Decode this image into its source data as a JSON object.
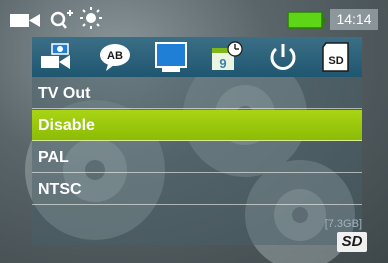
{
  "status": {
    "clock": "14:14",
    "icons": [
      "video-camera-icon",
      "zoom-icon",
      "white-balance-icon",
      "battery-icon"
    ],
    "battery_color": "#5cd615"
  },
  "tabs": [
    {
      "icon": "video-settings-icon"
    },
    {
      "icon": "language-icon",
      "text": "AB"
    },
    {
      "icon": "display-icon"
    },
    {
      "icon": "date-time-icon",
      "text": "9"
    },
    {
      "icon": "power-icon"
    },
    {
      "icon": "sd-card-icon",
      "text": "SD"
    }
  ],
  "menu": {
    "title": "TV Out",
    "options": [
      "Disable",
      "PAL",
      "NTSC"
    ],
    "selected": "Disable"
  },
  "storage": {
    "free": "[7.3GB]",
    "media": "SD"
  },
  "colors": {
    "selection": "#9acb0c",
    "tab_bar": "#2a6279",
    "accent_blue": "#1f7fd6"
  }
}
